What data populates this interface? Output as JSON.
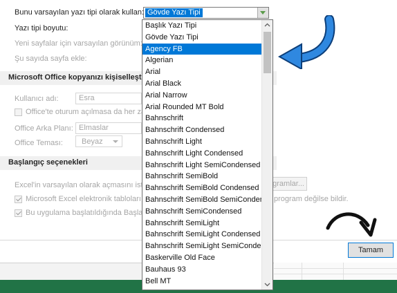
{
  "settings": {
    "default_font_label": "Bunu varsayılan yazı tipi olarak kullan:",
    "default_font_value": "Gövde Yazı Tipi",
    "font_size_label": "Yazı tipi boyutu:",
    "new_sheet_view_label": "Yeni sayfalar için varsayılan görünüm:",
    "sheet_count_label": "Şu sayıda sayfa ekle:"
  },
  "personalize": {
    "heading": "Microsoft Office kopyanızı kişiselleştirin",
    "username_label": "Kullanıcı adı:",
    "username_value": "Esra",
    "always_use_label": "Office'te oturum açılmasa da her zaman bu değerleri kullan",
    "background_label": "Office Arka Planı:",
    "background_value": "Elmaslar",
    "theme_label": "Office Teması:",
    "theme_value": "Beyaz"
  },
  "startup": {
    "heading": "Başlangıç seçenekleri",
    "default_programs_text": "Excel'in varsayılan olarak açmasını istediğiniz uzantıları seçin:",
    "default_programs_button": "Varsayılan Programlar...",
    "tell_me_label": "Microsoft Excel elektronik tabloları görüntülemek ve düzenlemek için varsayılan program değilse bildir.",
    "tell_me_suffix": "program değilse bildir.",
    "show_start_label": "Bu uygulama başlatıldığında Başlangıç ekranını göster"
  },
  "dialog": {
    "ok_label": "Tamam"
  },
  "font_dropdown": {
    "selected_index": 2,
    "items": [
      "Başlık Yazı Tipi",
      "Gövde Yazı Tipi",
      "Agency FB",
      "Algerian",
      "Arial",
      "Arial Black",
      "Arial Narrow",
      "Arial Rounded MT Bold",
      "Bahnschrift",
      "Bahnschrift Condensed",
      "Bahnschrift Light",
      "Bahnschrift Light Condensed",
      "Bahnschrift Light SemiCondensed",
      "Bahnschrift SemiBold",
      "Bahnschrift SemiBold Condensed",
      "Bahnschrift SemiBold SemiConden",
      "Bahnschrift SemiCondensed",
      "Bahnschrift SemiLight",
      "Bahnschrift SemiLight Condensed",
      "Bahnschrift SemiLight SemiConde",
      "Baskerville Old Face",
      "Bauhaus 93",
      "Bell MT"
    ]
  },
  "colors": {
    "selection": "#0078d7",
    "excel_green": "#217346",
    "annotation_arrow": "#1e73c8"
  },
  "annotations": {
    "blue_arrow_icon": "curved-arrow-pointing-left",
    "black_arrow_icon": "curved-arrow-pointing-down"
  }
}
